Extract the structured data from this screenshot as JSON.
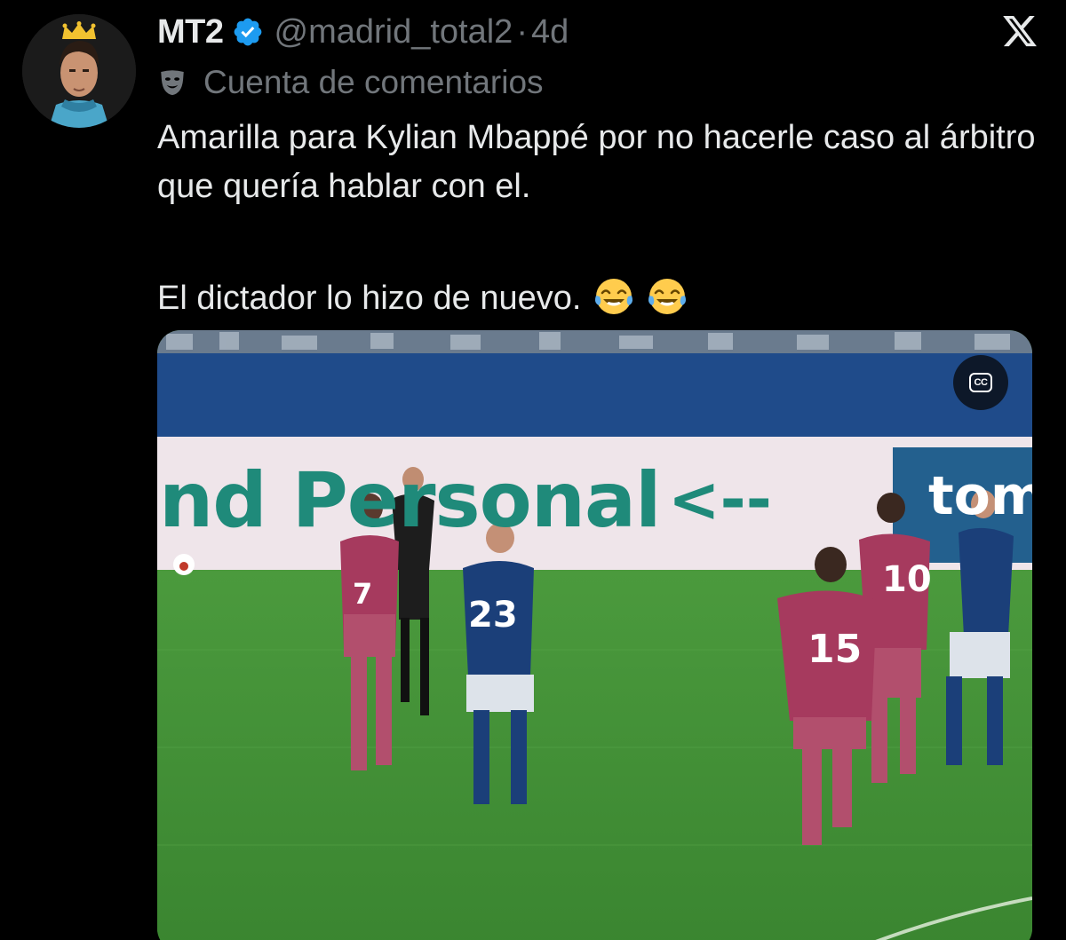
{
  "author": {
    "display_name": "MT2",
    "verified": true,
    "handle": "@madrid_total2",
    "separator": "·",
    "timestamp": "4d",
    "avatar_icon": "avatar-crown-icon"
  },
  "platform": {
    "logo_icon": "x-logo-icon"
  },
  "community": {
    "icon": "comedy-mask-icon",
    "label": "Cuenta de comentarios"
  },
  "tweet": {
    "line_1": "Amarilla para Kylian Mbappé por no hacerle caso al árbitro que quería hablar con el.",
    "line_2": "El dictador lo hizo de nuevo.",
    "emojis": [
      "face-with-tears-of-joy",
      "face-with-tears-of-joy"
    ]
  },
  "media": {
    "type": "video",
    "banner_text": "nd Personal",
    "banner_arrow": "<--",
    "banner_right_text": "tom",
    "player_numbers": [
      "7",
      "23",
      "10",
      "15"
    ],
    "cc_label": "CC"
  },
  "colors": {
    "background": "#000000",
    "text_primary": "#e7e9ea",
    "text_secondary": "#71767b",
    "verified_blue": "#1d9bf0",
    "pitch_green": "#3e8a36",
    "banner_teal": "#1f8a7a"
  }
}
